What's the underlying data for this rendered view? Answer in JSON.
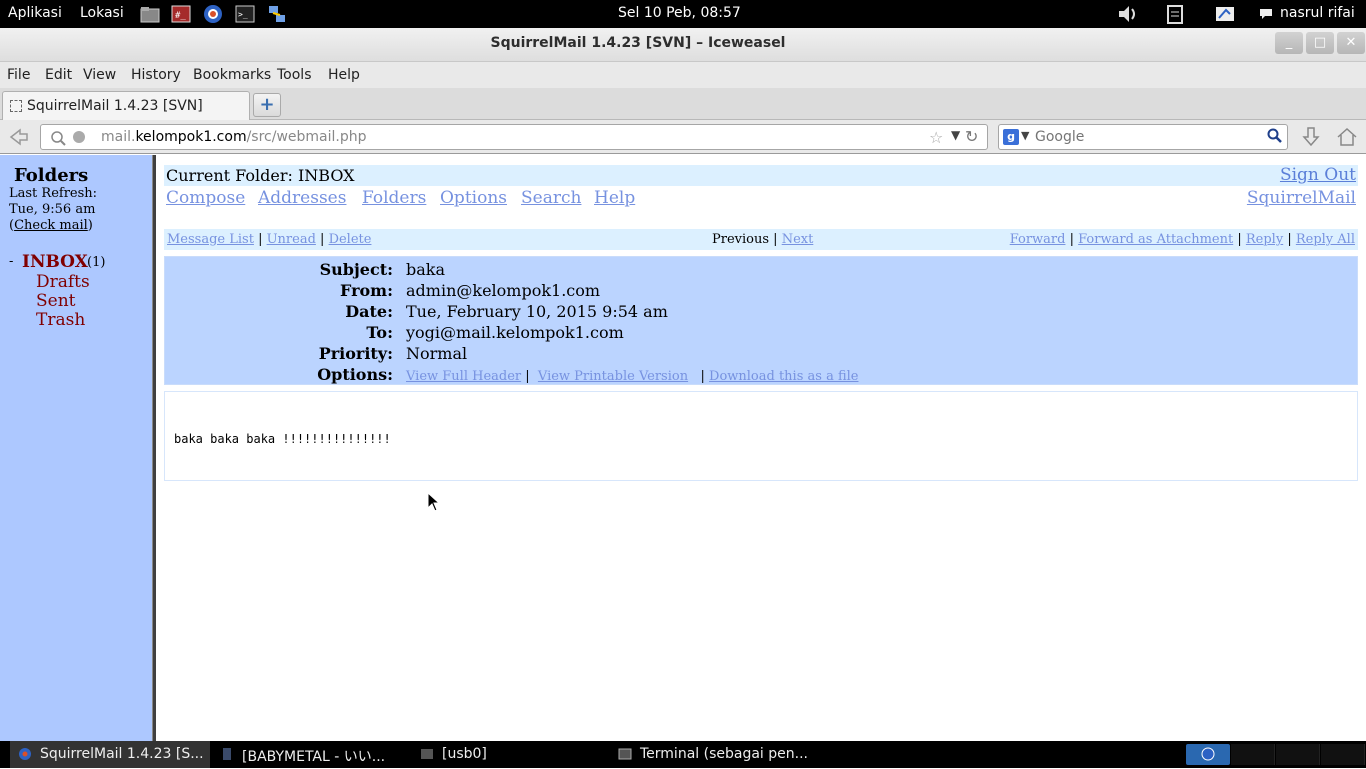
{
  "panel": {
    "menu_apps": "Aplikasi",
    "menu_places": "Lokasi",
    "clock": "Sel 10 Peb, 08:57",
    "user": "nasrul rifai",
    "icons": [
      "files-icon",
      "terminal-red-icon",
      "browser-icon",
      "console-icon",
      "network-icon",
      "volume-icon",
      "clipboard-icon",
      "accessibility-icon",
      "chat-icon"
    ]
  },
  "window": {
    "title": "SquirrelMail 1.4.23 [SVN] – Iceweasel",
    "buttons": {
      "minimize": "_",
      "maximize": "□",
      "close": "✕"
    }
  },
  "menubar": [
    "File",
    "Edit",
    "View",
    "History",
    "Bookmarks",
    "Tools",
    "Help"
  ],
  "tab": {
    "label": "SquirrelMail 1.4.23 [SVN]",
    "new_tab": "+"
  },
  "nav": {
    "url_domain_prefix": "mail.",
    "url_domain": "kelompok1.com",
    "url_path": "/src/webmail.php",
    "search_placeholder": "Google",
    "search_engine": "g"
  },
  "sidebar": {
    "title": "Folders",
    "last_refresh_label": "Last Refresh:",
    "last_refresh_time": "Tue, 9:56 am",
    "check_mail": "Check mail",
    "inbox": "INBOX",
    "inbox_unread": "(1)",
    "folders": [
      "Drafts",
      "Sent",
      "Trash"
    ]
  },
  "main": {
    "current_folder_label": "Current Folder:",
    "current_folder": "INBOX",
    "sign_out": "Sign Out",
    "links": [
      "Compose",
      "Addresses",
      "Folders",
      "Options",
      "Search",
      "Help"
    ],
    "brand_link": "SquirrelMail",
    "msgbar": {
      "message_list": "Message List",
      "unread": "Unread",
      "delete": "Delete",
      "previous": "Previous",
      "next": "Next",
      "forward": "Forward",
      "forward_attachment": "Forward as Attachment",
      "reply": "Reply",
      "reply_all": "Reply All"
    },
    "headers": {
      "subject_label": "Subject:",
      "subject": "baka",
      "from_label": "From:",
      "from": "admin@kelompok1.com",
      "date_label": "Date:",
      "date": "Tue, February 10, 2015 9:54 am",
      "to_label": "To:",
      "to": "yogi@mail.kelompok1.com",
      "priority_label": "Priority:",
      "priority": "Normal",
      "options_label": "Options:",
      "opt_full_header": "View Full Header",
      "opt_printable": "View Printable Version",
      "opt_download": "Download this as a file"
    },
    "body": "baka baka baka !!!!!!!!!!!!!!!"
  },
  "taskbar": [
    "SquirrelMail 1.4.23 [S...",
    "[BABYMETAL - いい...",
    "[usb0]",
    "Terminal (sebagai pen..."
  ],
  "colors": {
    "sidebar_bg": "#adc8ff",
    "header_bg": "#bbd4ff",
    "bar_bg": "#dcf0ff",
    "folder_link": "#800000",
    "link": "#7792e0"
  }
}
